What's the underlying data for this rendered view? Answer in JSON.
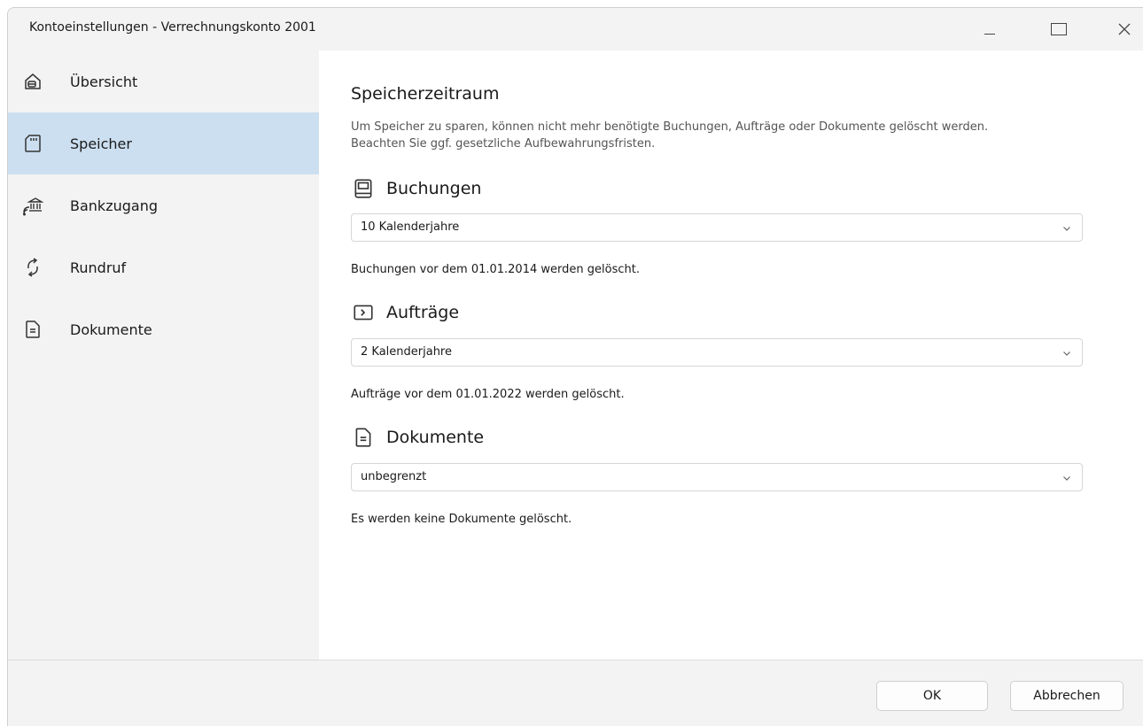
{
  "window": {
    "title": "Kontoeinstellungen - Verrechnungskonto 2001"
  },
  "sidebar": {
    "items": [
      {
        "label": "Übersicht",
        "icon": "overview-icon",
        "selected": false
      },
      {
        "label": "Speicher",
        "icon": "storage-card-icon",
        "selected": true
      },
      {
        "label": "Bankzugang",
        "icon": "bank-access-icon",
        "selected": false
      },
      {
        "label": "Rundruf",
        "icon": "sync-icon",
        "selected": false
      },
      {
        "label": "Dokumente",
        "icon": "document-icon",
        "selected": false
      }
    ]
  },
  "main": {
    "heading": "Speicherzeitraum",
    "description_line1": "Um Speicher zu sparen, können nicht mehr benötigte Buchungen, Aufträge oder Dokumente gelöscht werden.",
    "description_line2": "Beachten Sie ggf. gesetzliche Aufbewahrungsfristen.",
    "sections": [
      {
        "title": "Buchungen",
        "icon": "book-icon",
        "selected_value": "10 Kalenderjahre",
        "note": "Buchungen vor dem 01.01.2014 werden gelöscht."
      },
      {
        "title": "Aufträge",
        "icon": "order-icon",
        "selected_value": "2 Kalenderjahre",
        "note": "Aufträge vor dem 01.01.2022 werden gelöscht."
      },
      {
        "title": "Dokumente",
        "icon": "document-icon",
        "selected_value": "unbegrenzt",
        "note": "Es werden keine Dokumente gelöscht."
      }
    ]
  },
  "footer": {
    "ok_label": "OK",
    "cancel_label": "Abbrechen"
  },
  "colors": {
    "selected_nav": "#ccdff0",
    "chrome_bg": "#f3f3f3",
    "content_bg": "#ffffff"
  }
}
